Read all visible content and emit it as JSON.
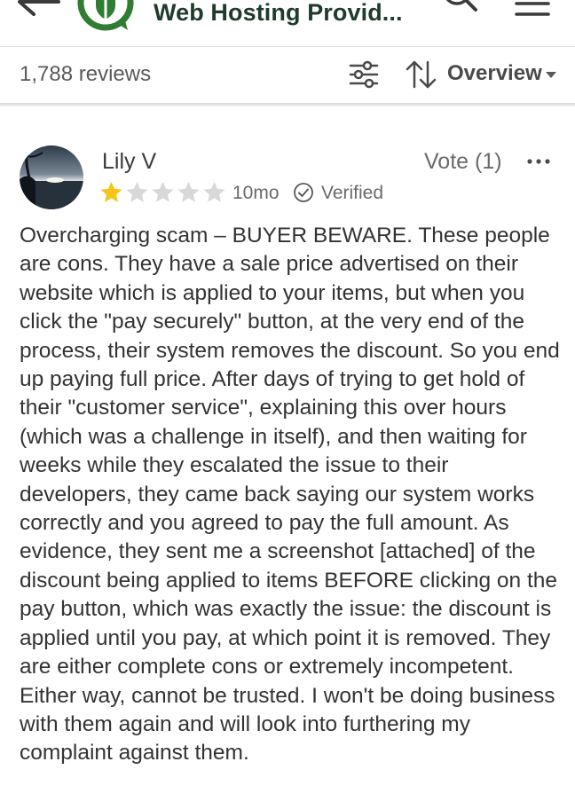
{
  "header": {
    "title": "Web Hosting Provid...",
    "back_icon": "arrow-left-icon",
    "logo_icon": "shield-chat-logo",
    "search_icon": "search-icon",
    "menu_icon": "hamburger-menu-icon",
    "brand_color": "#2e7d32"
  },
  "toolbar": {
    "reviews_count": "1,788 reviews",
    "filter_icon": "filter-sliders-icon",
    "sort_icon": "sort-arrows-icon",
    "sort_label": "Overview",
    "sort_caret_icon": "caret-down-icon"
  },
  "review": {
    "name": "Lily V",
    "rating": 1,
    "rating_max": 5,
    "star_color": "#f5c518",
    "star_empty_color": "#d8d8d8",
    "age": "10mo",
    "verified_label": "Verified",
    "vote_label": "Vote (1)",
    "more_icon": "more-dots-icon",
    "body": "Overcharging scam – BUYER BEWARE. These people are cons. They have a sale price advertised on their website which is applied to your items, but when you click the \"pay securely\" button, at the very end of the process, their system removes the discount. So you end up paying full price. After days of trying to get hold of their \"customer service\", explaining this over hours (which was a challenge in itself), and then waiting for weeks while they escalated the issue to their developers, they came back saying our system works correctly and you agreed to pay the full amount. As evidence, they sent me a screenshot [attached] of the discount being applied to items BEFORE clicking on the pay button, which was exactly the issue: the discount is applied until you pay, at which point it is removed. They are either complete cons or extremely incompetent. Either way, cannot be trusted. I won't be doing business with them again and will look into furthering my complaint against them."
  }
}
